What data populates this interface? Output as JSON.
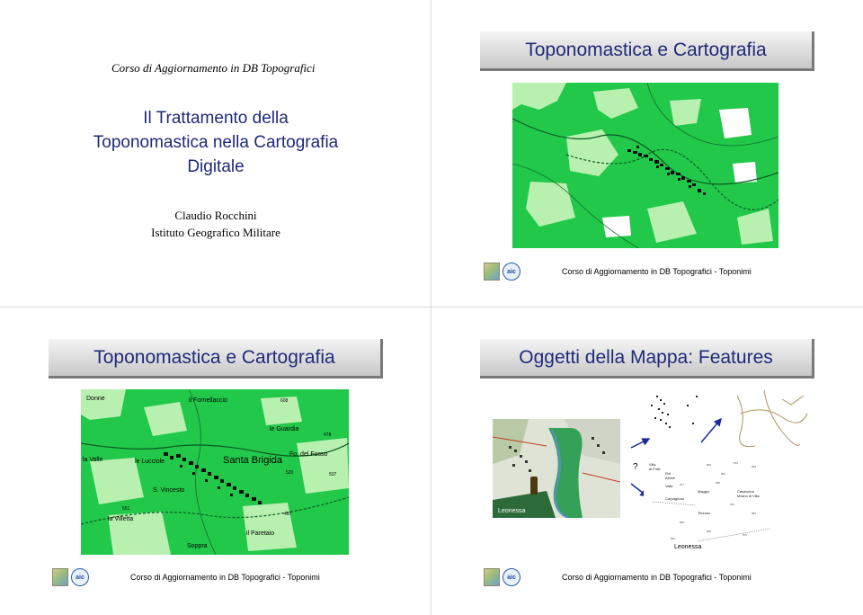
{
  "slide1": {
    "header": "Corso di Aggiornamento in DB Topografici",
    "title_lines": [
      "Il Trattamento della",
      "Toponomastica nella Cartografia",
      "Digitale"
    ],
    "author": "Claudio Rocchini",
    "institute": "Istituto Geografico Militare"
  },
  "slide2": {
    "title": "Toponomastica e Cartografia",
    "footer": "Corso di Aggiornamento in DB Topografici - Toponimi",
    "logo_label": "aic"
  },
  "slide3": {
    "title": "Toponomastica e Cartografia",
    "footer": "Corso di Aggiornamento in DB Topografici - Toponimi",
    "logo_label": "aic",
    "map_labels": {
      "fornellaccio": "il Fornellaccio",
      "guardia": "le Guardia",
      "valle": "la Valle",
      "lucciole": "le Lucciole",
      "santa_brigida": "Santa Brigida",
      "vincesto": "S. Vincesto",
      "villetta": "la Villetta",
      "sopprao": "Soppra",
      "paretaio": "il Paretaio",
      "doone": "Donne",
      "fosso": "Fo. del Fosso",
      "h1": "608",
      "h2": "478",
      "h3": "520",
      "h4": "537",
      "h5": "407",
      "h6": "551"
    }
  },
  "slide4": {
    "title": "Oggetti della Mappa: Features",
    "footer": "Corso di Aggiornamento in DB Topografici - Toponimi",
    "logo_label": "aic",
    "question_mark": "?",
    "leonessa_photo": "Leonessa",
    "leonessa_text": "Leonessa",
    "text_fragments": [
      "Villa",
      "di Fratt",
      "Ruf",
      "Albine",
      "Valle",
      "Maggio",
      "Casaccina",
      "Molino di Villa",
      "Carpagnola",
      "Terzano"
    ]
  },
  "colors": {
    "title_text": "#1f2a7a",
    "map_green": "#22c84a",
    "map_light": "#b8f0b0"
  }
}
